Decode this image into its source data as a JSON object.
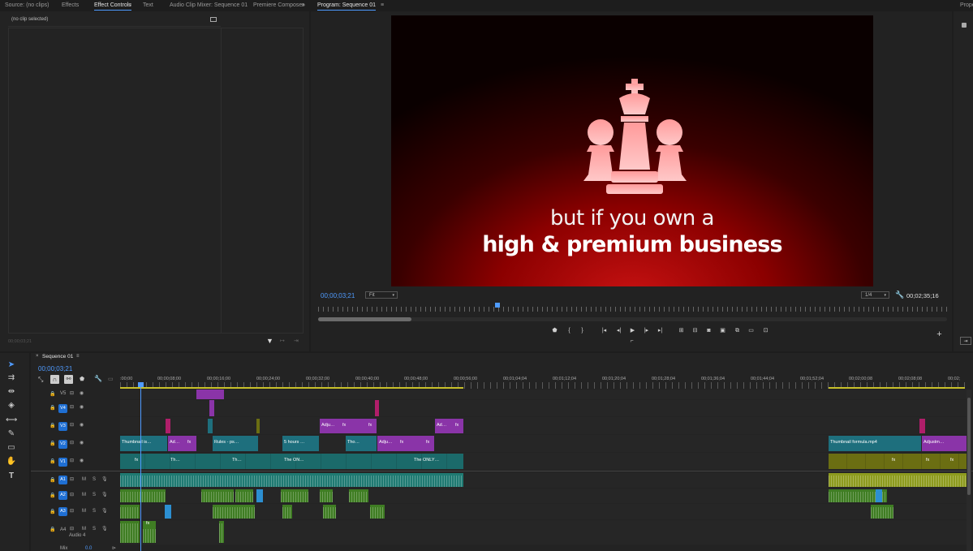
{
  "top_tabs": {
    "source": "Source: (no clips)",
    "effects": "Effects",
    "effect_controls": "Effect Controls",
    "text": "Text",
    "audio_mixer": "Audio Clip Mixer: Sequence 01",
    "premiere_composer": "Premiere Composer",
    "overflow": "»"
  },
  "effect_controls": {
    "no_clip": "(no clip selected)",
    "timecode": "00;00;03;21"
  },
  "program": {
    "title": "Program: Sequence 01",
    "timecode": "00;00;03;21",
    "zoom": "Fit",
    "resolution": "1/4",
    "duration": "00;02;35;16",
    "caption_line1": "but if you own a",
    "caption_line2": "high & premium business",
    "playhead_fraction": 0.17
  },
  "properties": {
    "title": "Prope"
  },
  "timeline": {
    "sequence_name": "Sequence 01",
    "timecode": "00;00;03;21",
    "ruler": [
      ":00;00",
      "00;00;08;00",
      "00;00;16;00",
      "00;00;24;00",
      "00;00;32;00",
      "00;00;40;00",
      "00;00;48;00",
      "00;00;56;00",
      "00;01;04;04",
      "00;01;12;04",
      "00;01;20;04",
      "00;01;28;04",
      "00;01;36;04",
      "00;01;44;04",
      "00;01;52;04",
      "00;02;00;08",
      "00;02;08;08",
      "00;02;"
    ],
    "tracks": {
      "v5": "V5",
      "v4": "V4",
      "v3": "V3",
      "v2": "V2",
      "v1": "V1",
      "a1": "A1",
      "a2": "A2",
      "a3": "A3",
      "a4": "A4",
      "audio4": "Audio 4",
      "mix": "Mix",
      "mix_value": "0.0",
      "m": "M",
      "s": "S"
    },
    "clips": {
      "v3_adj1": "Adju…",
      "v3_fx1": "fx",
      "v3_fx2": "fx",
      "v3_ad": "Ad…",
      "v3_fx3": "fx",
      "v2_thumb": "Thumbnail is…",
      "v2_ad": "Ad…",
      "v2_fx": "fx",
      "v2_rules": "Rules - ps…",
      "v2_5h": "5 hours …",
      "v2_tho": "Tho…",
      "v2_adju": "Adju…",
      "v2_fx2": "fx",
      "v2_fx3": "fx",
      "v2_thumb2": "Thumbnail formula.mp4",
      "v2_adjustm": "Adjustm…",
      "v1_fx": "fx",
      "v1_th": "Th…",
      "v1_theon": "The ON…",
      "v1_theonly": "The ONLY…",
      "a4_fx": "fx"
    }
  },
  "colors": {
    "accent": "#4f9bff",
    "purple_clip": "#8a34a8",
    "teal_clip": "#1e6f7d",
    "video_red": "#8b0000"
  }
}
